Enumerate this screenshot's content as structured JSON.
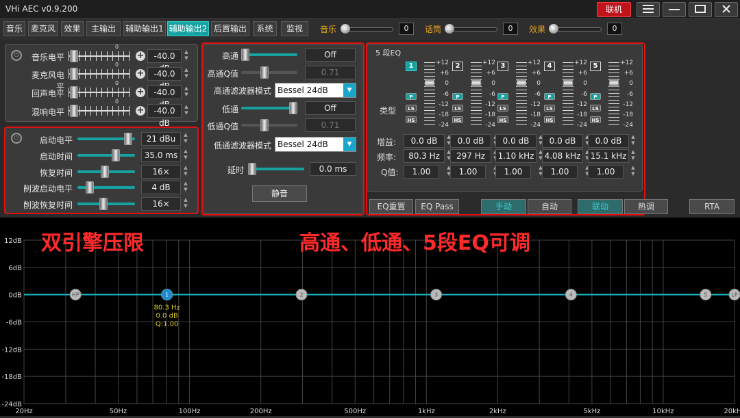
{
  "window": {
    "title": "VHi AEC v0.9.200",
    "connect_label": "联机"
  },
  "tabs": [
    "音乐",
    "麦克风",
    "效果",
    "主输出",
    "辅助输出1",
    "辅助输出2",
    "后置输出",
    "系统",
    "监视"
  ],
  "active_tab_index": 5,
  "levels": [
    {
      "label": "音乐",
      "value": "0"
    },
    {
      "label": "话筒",
      "value": "0"
    },
    {
      "label": "效果",
      "value": "0"
    }
  ],
  "mix": {
    "rows": [
      {
        "label": "音乐电平",
        "value": "-40.0 dB",
        "top_mark": "0"
      },
      {
        "label": "麦克风电平",
        "value": "-40.0 dB",
        "top_mark": "0"
      },
      {
        "label": "回声电平",
        "value": "-40.0 dB",
        "top_mark": "0"
      },
      {
        "label": "混响电平",
        "value": "-40.0 dB",
        "top_mark": "0"
      }
    ]
  },
  "limiter": {
    "rows": [
      {
        "label": "启动电平",
        "value": "21 dBu"
      },
      {
        "label": "启动时间",
        "value": "35.0 ms"
      },
      {
        "label": "恢复时间",
        "value": "16×"
      },
      {
        "label": "削波启动电平",
        "value": "4 dB"
      },
      {
        "label": "削波恢复时间",
        "value": "16×"
      }
    ]
  },
  "filters": {
    "hp_label": "高通",
    "hp_value": "Off",
    "hpq_label": "高通Q值",
    "hpq_value": "0.71",
    "hp_mode_label": "高通滤波器模式",
    "hp_mode_value": "Bessel 24dB",
    "lp_label": "低通",
    "lp_value": "Off",
    "lpq_label": "低通Q值",
    "lpq_value": "0.71",
    "lp_mode_label": "低通滤波器模式",
    "lp_mode_value": "Bessel 24dB",
    "delay_label": "延时",
    "delay_value": "0.0 ms",
    "mute_label": "静音"
  },
  "eq": {
    "title": "5 段EQ",
    "type_label": "类型",
    "gain_label": "增益:",
    "freq_label": "频率:",
    "q_label": "Q值:",
    "scale": [
      "+12",
      "+6",
      "0",
      "-6",
      "-12",
      "-18",
      "-24"
    ],
    "type_buttons": [
      "P",
      "LS",
      "HS"
    ],
    "bands": [
      {
        "num": "1",
        "gain": "0.0 dB",
        "freq": "80.3 Hz",
        "q": "1.00"
      },
      {
        "num": "2",
        "gain": "0.0 dB",
        "freq": "297 Hz",
        "q": "1.00"
      },
      {
        "num": "3",
        "gain": "0.0 dB",
        "freq": "1.10 kHz",
        "q": "1.00"
      },
      {
        "num": "4",
        "gain": "0.0 dB",
        "freq": "4.08 kHz",
        "q": "1.00"
      },
      {
        "num": "5",
        "gain": "0.0 dB",
        "freq": "15.1 kHz",
        "q": "1.00"
      }
    ],
    "reset_label": "EQ重置",
    "pass_label": "EQ Pass",
    "manual_label": "手动",
    "auto_label": "自动",
    "link_label": "联动",
    "hot_label": "热调",
    "rta_label": "RTA"
  },
  "annotations": {
    "left": "双引擎压限",
    "right": "高通、低通、5段EQ可调"
  },
  "graph": {
    "y_labels": [
      "12dB",
      "6dB",
      "0dB",
      "-6dB",
      "-12dB",
      "-18dB",
      "-24dB"
    ],
    "x_labels": [
      "20Hz",
      "50Hz",
      "100Hz",
      "200Hz",
      "500Hz",
      "1kHz",
      "2kHz",
      "5kHz",
      "10kHz",
      "20kHz"
    ],
    "nodes": [
      "HP",
      "1",
      "2",
      "3",
      "4",
      "5",
      "LP"
    ],
    "selected_info": [
      "80.3 Hz",
      "0.0 dB",
      "Q:1.00"
    ],
    "curve_color": "#17b3c0"
  }
}
